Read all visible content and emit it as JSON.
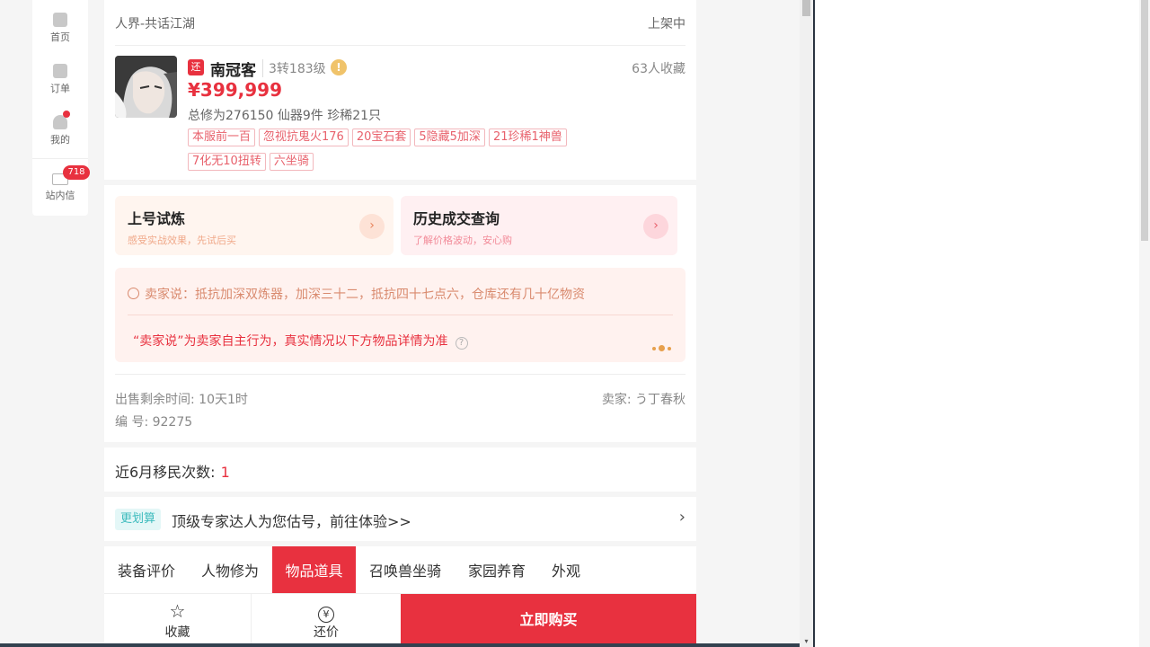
{
  "nav": {
    "home": "首页",
    "orders": "订单",
    "mine": "我的",
    "inbox": "站内信",
    "inbox_badge": "718"
  },
  "item": {
    "server": "人界-共话江湖",
    "status": "上架中",
    "tag": "还",
    "name": "南冠客",
    "level": "3转183级",
    "favorites": "63人收藏",
    "price": "¥399,999",
    "stats": "总修为276150  仙器9件  珍稀21只",
    "tags": [
      "本服前一百",
      "忽视抗鬼火176",
      "20宝石套",
      "5隐藏5加深",
      "21珍稀1神兽",
      "7化无10扭转",
      "六坐骑"
    ]
  },
  "promos": [
    {
      "title": "上号试炼",
      "subtitle": "感受实战效果，先试后买"
    },
    {
      "title": "历史成交查询",
      "subtitle": "了解价格波动，安心购"
    }
  ],
  "seller_note": {
    "says": "卖家说：抵抗加深双炼器，加深三十二，抵抗四十七点六，仓库还有几十亿物资",
    "disclaimer": "“卖家说”为卖家自主行为，真实情况以下方物品详情为准"
  },
  "sale": {
    "time_left": "出售剩余时间: 10天1时",
    "seller": "卖家: う丁春秋",
    "serial": "编 号: 92275"
  },
  "migration": {
    "label": "近6月移民次数:",
    "value": "1"
  },
  "estimate": {
    "badge": "更划算",
    "text": "顶级专家达人为您估号，前往体验>>"
  },
  "tabs": [
    "装备评价",
    "人物修为",
    "物品道具",
    "召唤兽坐骑",
    "家园养育",
    "外观"
  ],
  "active_tab": "物品道具",
  "bottom": {
    "favorite": "收藏",
    "counter_offer": "还价",
    "buy_now": "立即购买"
  },
  "colors": {
    "accent": "#e8313f",
    "teal": "#3dbbbd"
  }
}
